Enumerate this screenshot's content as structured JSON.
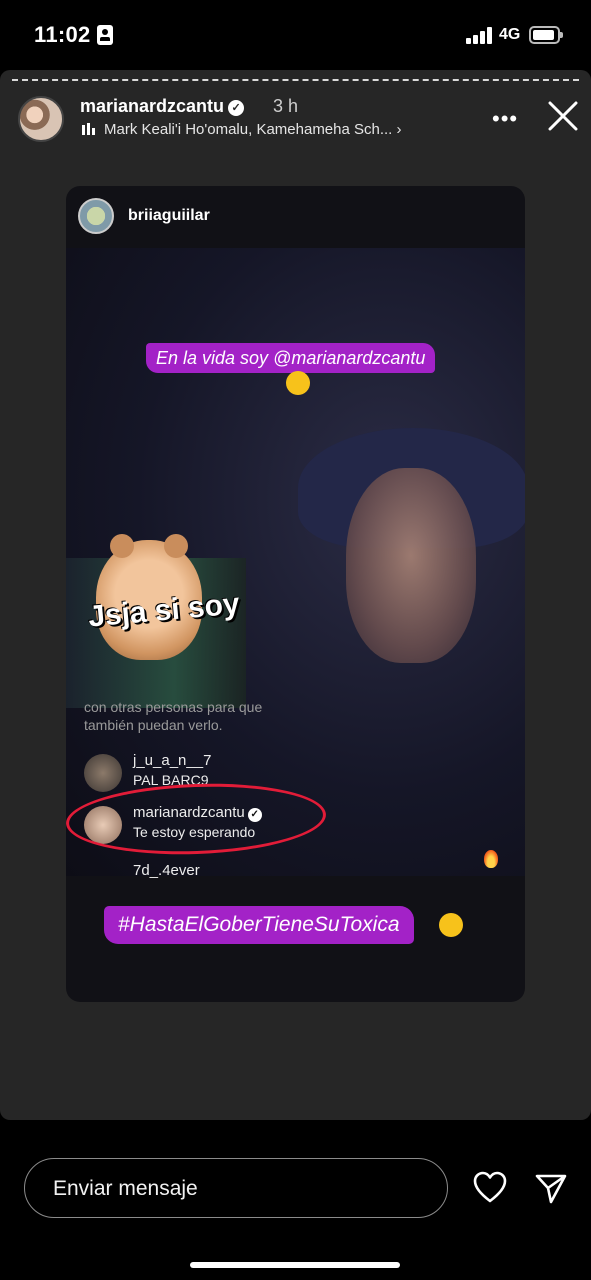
{
  "status_bar": {
    "time": "11:02",
    "network": "4G"
  },
  "story": {
    "username": "marianardzcantu",
    "age": "3 h",
    "music": "Mark Keali'i Ho'omalu, Kamehameha Sch... ›"
  },
  "post": {
    "username": "briiaguiilar",
    "sticker_top": "En la vida soy @marianardzcantu",
    "hamster_caption": "Jsja si soy",
    "faded_comment": [
      "con otras personas para que",
      "también puedan verlo."
    ],
    "comments": [
      {
        "name": "j_u_a_n__7",
        "text": "PAL BARC9"
      },
      {
        "name": "marianardzcantu",
        "text": "Te estoy esperando"
      },
      {
        "name": "7d_.4ever",
        "text": ""
      }
    ],
    "hashtag": "#HastaElGoberTieneSuToxica"
  },
  "bottom": {
    "message_placeholder": "Enviar mensaje"
  },
  "colors": {
    "accent_purple": "#a322c7",
    "ring_red": "#e21c38",
    "panel": "#262626"
  }
}
